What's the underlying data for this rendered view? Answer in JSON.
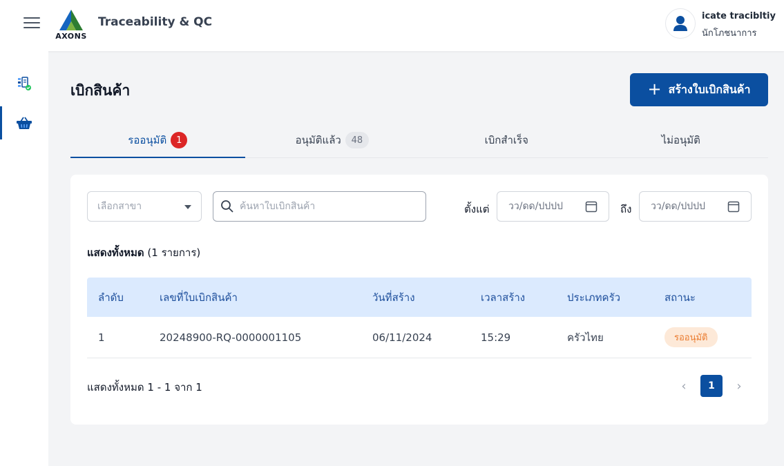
{
  "header": {
    "logo_text": "AXONS",
    "title": "Traceability & QC",
    "user_name": "icate tracibltiy",
    "user_role": "นักโภชนาการ"
  },
  "sidebar": {
    "items": [
      {
        "icon": "inventory-check-icon",
        "active": false
      },
      {
        "icon": "basket-icon",
        "active": true
      }
    ]
  },
  "page": {
    "title": "เบิกสินค้า",
    "create_button": "สร้างใบเบิกสินค้า",
    "create_icon": "+"
  },
  "tabs": [
    {
      "label": "รออนุมัติ",
      "count": "1",
      "active": true
    },
    {
      "label": "อนุมัติแล้ว",
      "count": "48",
      "active": false
    },
    {
      "label": "เบิกสำเร็จ",
      "count": "",
      "active": false
    },
    {
      "label": "ไม่อนุมัติ",
      "count": "",
      "active": false
    }
  ],
  "filters": {
    "branch_placeholder": "เลือกสาขา",
    "search_placeholder": "ค้นหาใบเบิกสินค้า",
    "from_label": "ตั้งแต่",
    "to_label": "ถึง",
    "date_placeholder_from": "วว/ดด/ปปปป",
    "date_placeholder_to": "วว/ดด/ปปปป"
  },
  "summary": {
    "label": "แสดงทั้งหมด",
    "count": "(1 รายการ)"
  },
  "table": {
    "headers": [
      "ลำดับ",
      "เลขที่ใบเบิกสินค้า",
      "วันที่สร้าง",
      "เวลาสร้าง",
      "ประเภทครัว",
      "สถานะ"
    ],
    "rows": [
      {
        "no": "1",
        "doc_no": "20248900-RQ-0000001105",
        "date": "06/11/2024",
        "time": "15:29",
        "kitchen": "ครัวไทย",
        "status": "รออนุมัติ"
      }
    ]
  },
  "pagination": {
    "summary": "แสดงทั้งหมด 1 - 1 จาก 1",
    "current_page": "1",
    "prev": "‹",
    "next": "›"
  },
  "colors": {
    "primary": "#0b4fa0",
    "badge_red": "#dc2626",
    "status_bg": "#fde9d8",
    "status_text": "#ea7a2d",
    "table_header_bg": "#dbeafe"
  }
}
